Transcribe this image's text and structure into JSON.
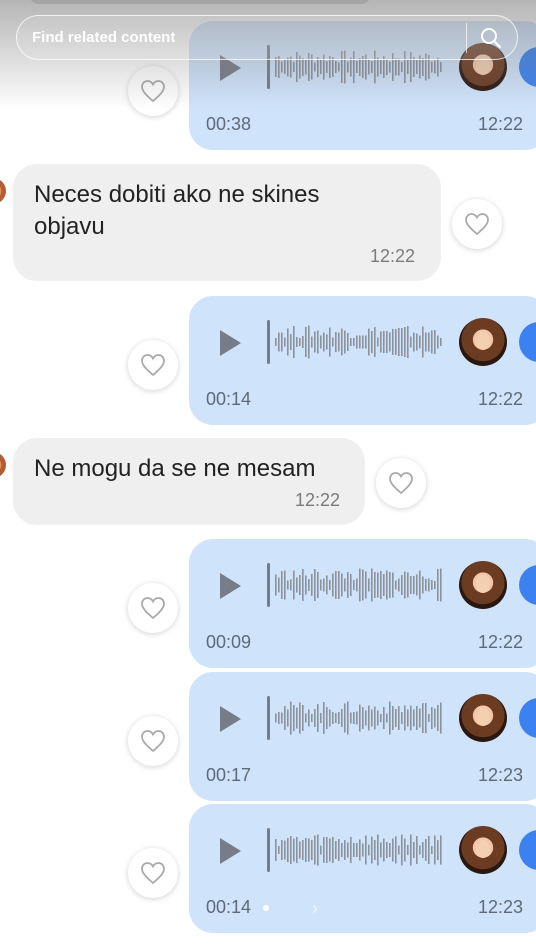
{
  "search": {
    "placeholder": "Find related content"
  },
  "messages": [
    {
      "type": "voice",
      "duration": "00:38",
      "time": "12:22"
    },
    {
      "type": "text",
      "lines": [
        "Neces dobiti ako ne skines",
        "objavu"
      ],
      "time": "12:22"
    },
    {
      "type": "voice",
      "duration": "00:14",
      "time": "12:22"
    },
    {
      "type": "text",
      "lines": [
        "Ne mogu da se ne mesam"
      ],
      "time": "12:22"
    },
    {
      "type": "voice",
      "duration": "00:09",
      "time": "12:22"
    },
    {
      "type": "voice",
      "duration": "00:17",
      "time": "12:23"
    },
    {
      "type": "voice",
      "duration": "00:14",
      "time": "12:23"
    }
  ],
  "colors": {
    "voice_bubble": "#cfe3fb",
    "text_bubble": "#efefef",
    "accent_blue": "#3b82f0",
    "icon_gray": "#767c88"
  },
  "icons": [
    "search-icon",
    "play-icon",
    "heart-icon",
    "avatar",
    "waveform"
  ]
}
